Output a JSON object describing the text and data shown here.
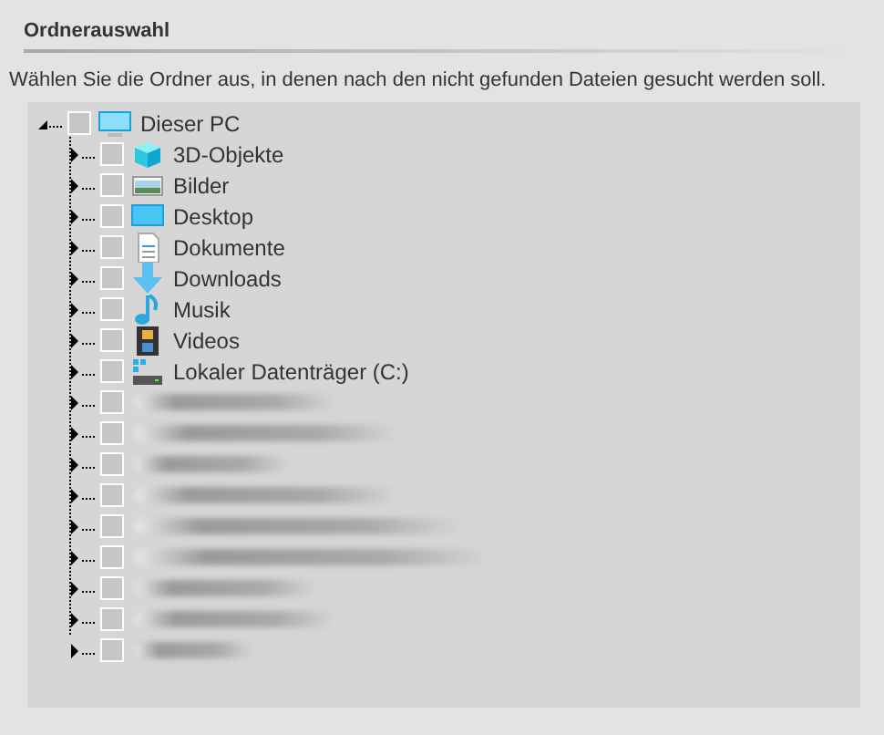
{
  "section": {
    "title": "Ordnerauswahl",
    "description": "Wählen Sie die Ordner aus, in denen nach den nicht gefunden Dateien gesucht werden soll."
  },
  "tree": {
    "label": "Dieser PC",
    "checked": false,
    "expanded": true,
    "children": [
      {
        "kind": "folder",
        "label": "3D-Objekte",
        "checked": false,
        "expanded": false
      },
      {
        "kind": "folder",
        "label": "Bilder",
        "checked": false,
        "expanded": false
      },
      {
        "kind": "folder",
        "label": "Desktop",
        "checked": false,
        "expanded": false
      },
      {
        "kind": "folder",
        "label": "Dokumente",
        "checked": false,
        "expanded": false
      },
      {
        "kind": "folder",
        "label": "Downloads",
        "checked": false,
        "expanded": false
      },
      {
        "kind": "folder",
        "label": "Musik",
        "checked": false,
        "expanded": false
      },
      {
        "kind": "folder",
        "label": "Videos",
        "checked": false,
        "expanded": false
      },
      {
        "kind": "folder",
        "label": "Lokaler Datenträger (C:)",
        "checked": false,
        "expanded": false
      },
      {
        "kind": "redacted",
        "checked": false,
        "expanded": false
      },
      {
        "kind": "redacted",
        "checked": false,
        "expanded": false
      },
      {
        "kind": "redacted",
        "checked": false,
        "expanded": false
      },
      {
        "kind": "redacted",
        "checked": false,
        "expanded": false
      },
      {
        "kind": "redacted",
        "checked": false,
        "expanded": false
      },
      {
        "kind": "redacted",
        "checked": false,
        "expanded": false
      },
      {
        "kind": "redacted",
        "checked": false,
        "expanded": false
      },
      {
        "kind": "redacted",
        "checked": false,
        "expanded": false
      },
      {
        "kind": "redacted",
        "checked": false,
        "expanded": false
      }
    ]
  }
}
